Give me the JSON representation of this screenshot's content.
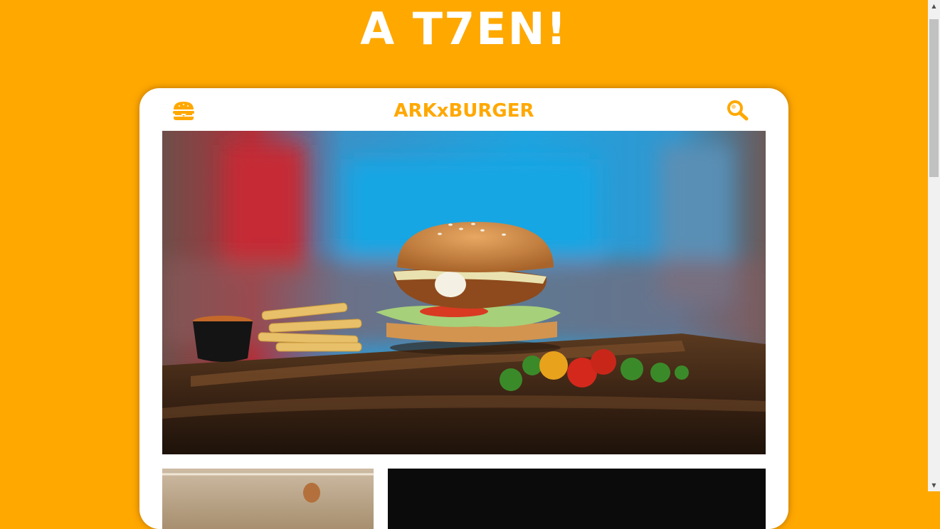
{
  "page": {
    "title": "A T7EN!"
  },
  "header": {
    "brand": "ARKxBURGER",
    "menu_icon": "burger-icon",
    "search_icon": "search-icon"
  },
  "hero": {
    "image": "burger-with-fries-photo"
  },
  "thumbnails": [
    {
      "image": "wooden-tabletop-photo"
    },
    {
      "image": "dark-photo"
    }
  ],
  "colors": {
    "background": "#FFA800",
    "card": "#FFFFFF",
    "brand_text": "#FFA800",
    "title_text": "#FFFFFF"
  },
  "scrollbar": {
    "up_arrow": "▲",
    "down_arrow": "▼"
  }
}
